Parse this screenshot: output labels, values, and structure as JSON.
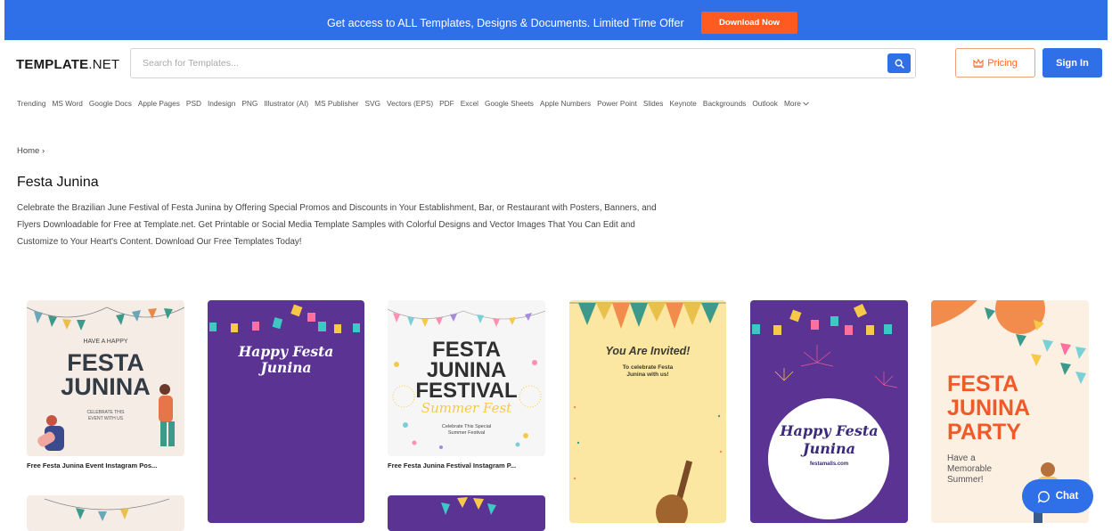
{
  "promo": {
    "text": "Get access to ALL Templates, Designs & Documents. Limited Time Offer",
    "button_label": "Download Now"
  },
  "header": {
    "logo_bold": "TEMPLATE",
    "logo_light": ".NET",
    "search_placeholder": "Search for Templates...",
    "pricing_label": "Pricing",
    "signin_label": "Sign In"
  },
  "nav": {
    "items": [
      "Trending",
      "MS Word",
      "Google Docs",
      "Apple Pages",
      "PSD",
      "Indesign",
      "PNG",
      "Illustrator (AI)",
      "MS Publisher",
      "SVG",
      "Vectors (EPS)",
      "PDF",
      "Excel",
      "Google Sheets",
      "Apple Numbers",
      "Power Point",
      "Slides",
      "Keynote",
      "Backgrounds",
      "Outlook",
      "More"
    ]
  },
  "breadcrumb": {
    "home": "Home",
    "separator": "›"
  },
  "page": {
    "title": "Festa Junina",
    "description": "Celebrate the Brazilian June Festival of Festa Junina by Offering Special Promos and Discounts in Your Establishment, Bar, or Restaurant with Posters, Banners, and Flyers Downloadable for Free at Template.net. Get Printable or Social Media Template Samples with Colorful Designs and Vector Images That You Can Edit and Customize to Your Heart's Content. Download Our Free Templates Today!"
  },
  "cards": [
    {
      "caption": "Free Festa Junina Event Instagram Pos...",
      "line1": "HAVE A HAPPY",
      "line2": "FESTA",
      "line3": "JUNINA",
      "line4": "CELEBRATE THIS",
      "line5": "EVENT WITH US"
    },
    {
      "line1": "Happy Festa",
      "line2": "Junina"
    },
    {
      "caption": "Free Festa Junina Festival Instagram P...",
      "line1": "FESTA",
      "line2": "JUNINA",
      "line3": "FESTIVAL",
      "line4": "Summer Fest",
      "line5": "Celebrate This Special",
      "line6": "Summer Festival"
    },
    {
      "line1": "You Are Invited!",
      "line2": "To celebrate Festa",
      "line3": "Junina with us!"
    },
    {
      "line1": "Happy Festa",
      "line2": "Junina",
      "line3": "festamalls.com"
    },
    {
      "line1": "FESTA",
      "line2": "JUNINA",
      "line3": "PARTY",
      "line4": "Have a",
      "line5": "Memorable",
      "line6": "Summer!"
    }
  ],
  "chat": {
    "label": "Chat"
  },
  "colors": {
    "accent": "#2f6fe8",
    "orange": "#ff5a1f",
    "purple": "#5b3493"
  }
}
